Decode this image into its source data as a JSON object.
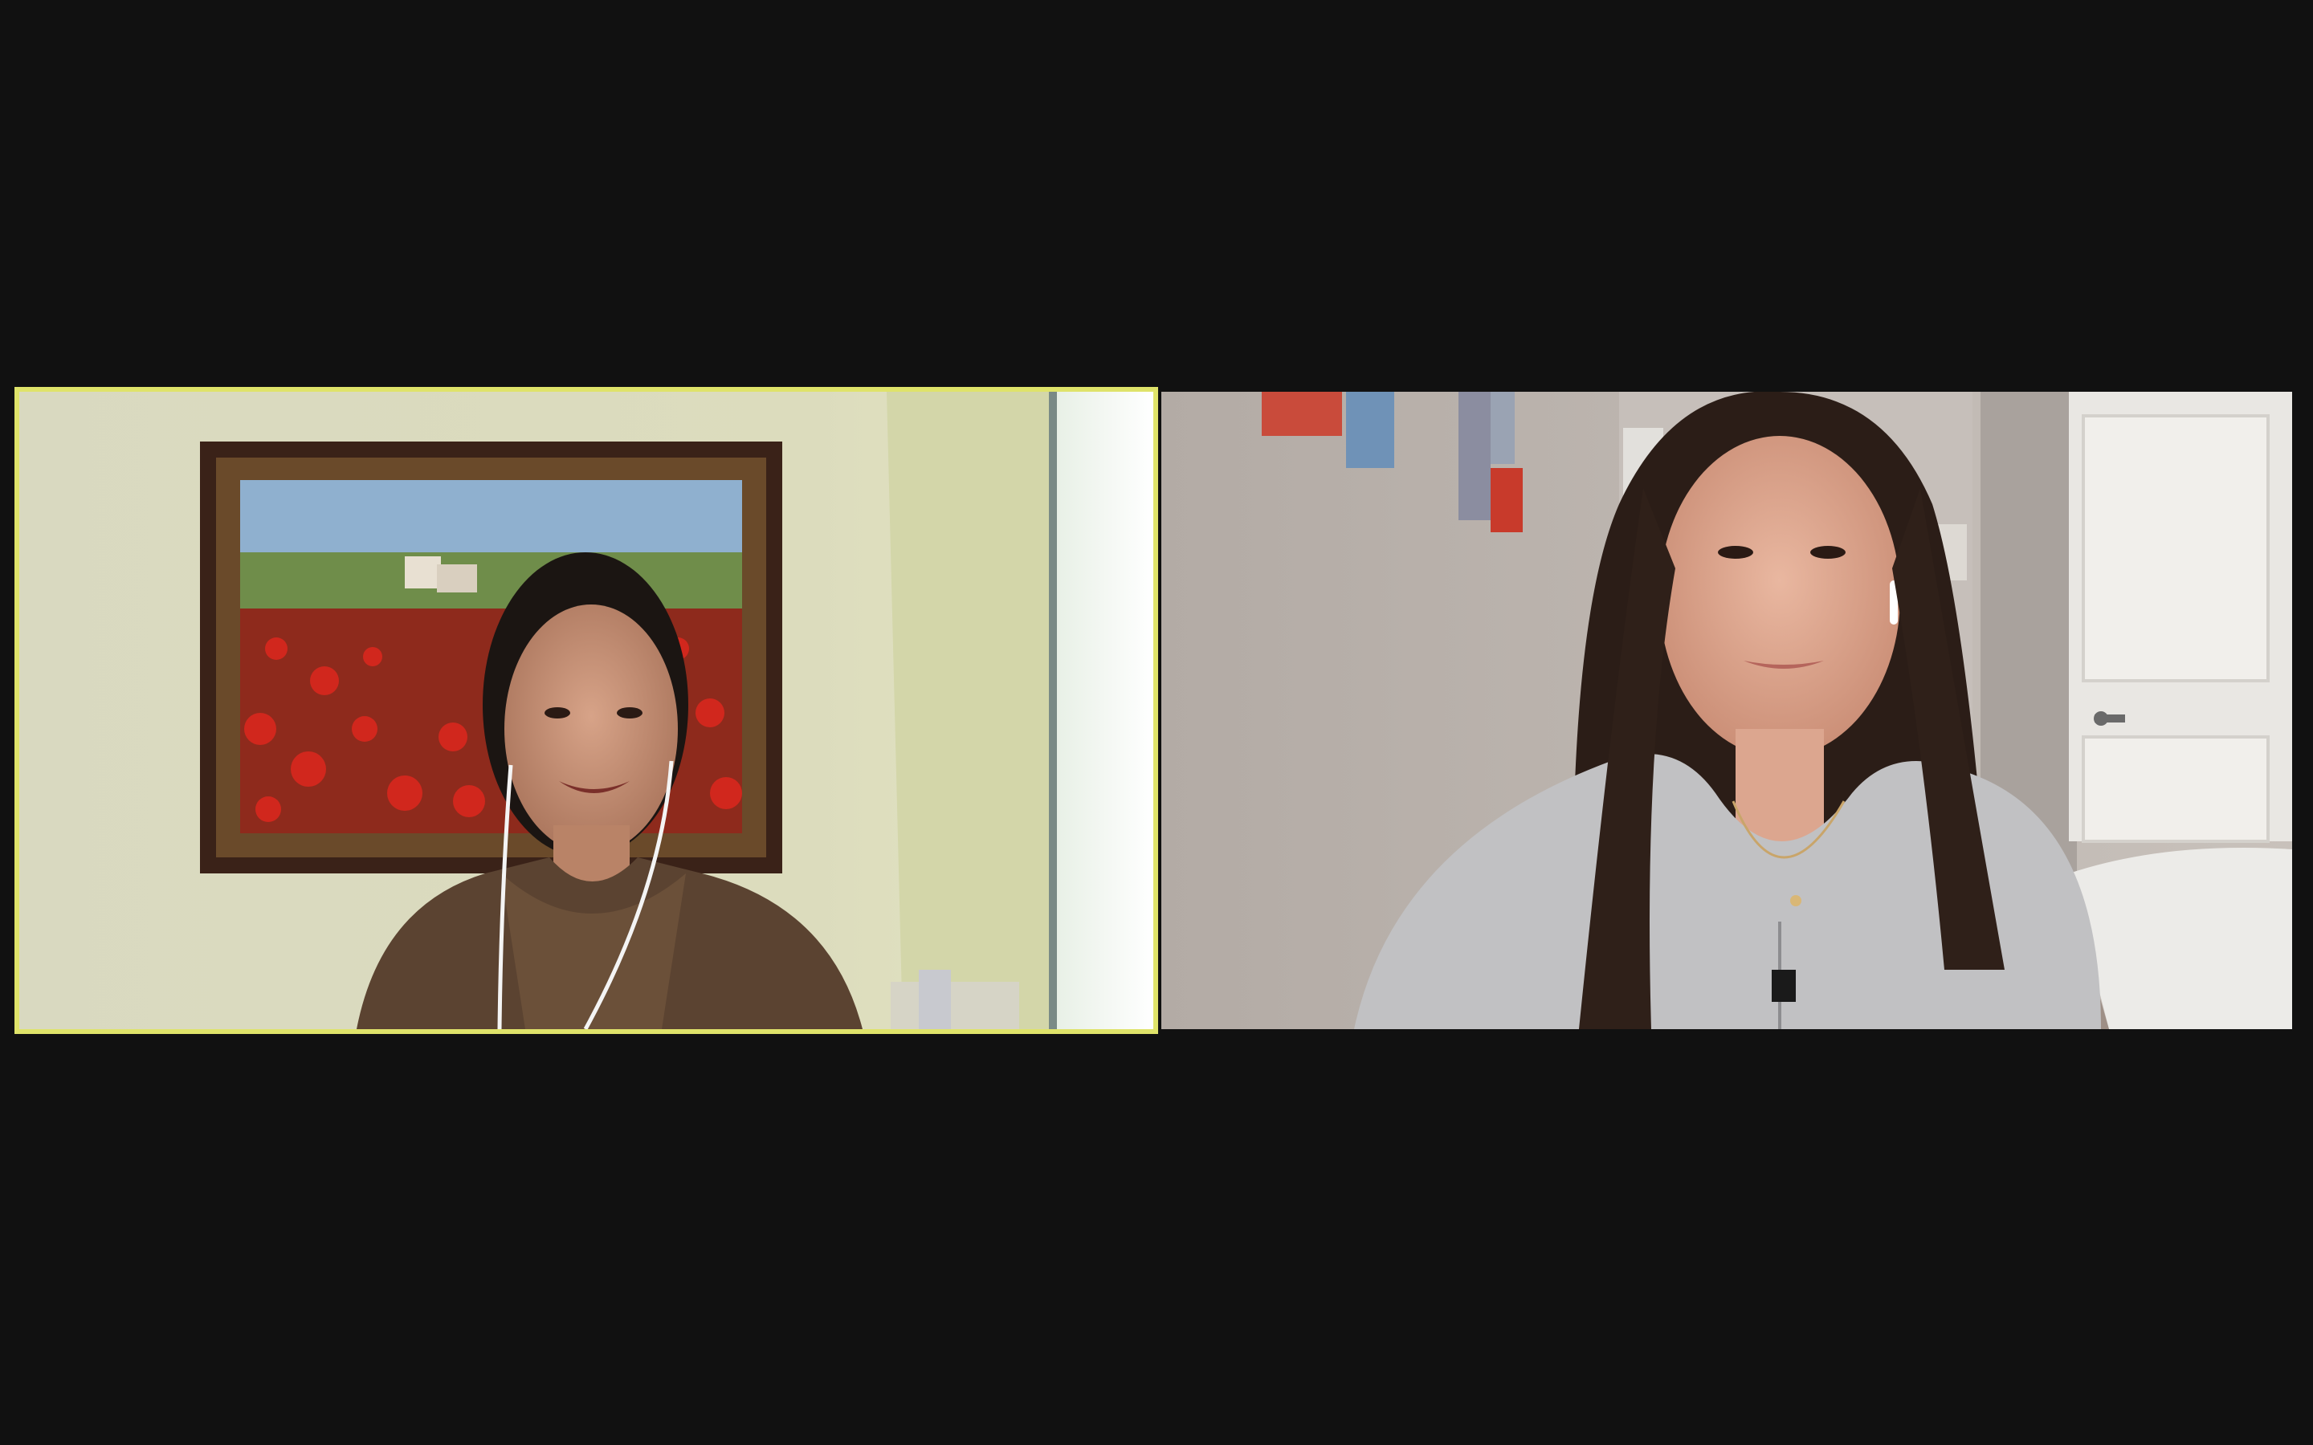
{
  "app": {
    "view_mode": "gallery",
    "background_color": "#111111"
  },
  "participants": [
    {
      "id": "left",
      "role": "active-speaker",
      "highlight_color": "#dfe36a",
      "name_label": ""
    },
    {
      "id": "right",
      "role": "participant",
      "name_label": ""
    }
  ]
}
